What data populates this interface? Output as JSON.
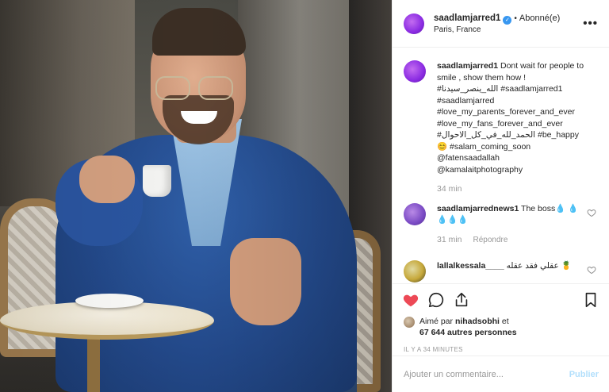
{
  "post": {
    "username": "saadlamjarred1",
    "verified_glyph": "✓",
    "follow_status": "Abonné(e)",
    "location": "Paris, France",
    "more_glyph": "•••"
  },
  "caption": {
    "username": "saadlamjarred1",
    "text": "Dont wait for people to smile , show them how ! #الله_ينصر_سيدنا #saadlamjarred1 #saadlamjarred #love_my_parents_forever_and_ever #love_my_fans_forever_and_ever #الحمد_لله_في_كل_الاحوال #be_happy😊 #salam_coming_soon @fatensaadallah @kamalaitphotography",
    "time": "34 min"
  },
  "comments": [
    {
      "username": "saadlamjarrednews1",
      "text": "The boss💧 💧💧💧💧",
      "time": "31 min",
      "reply": "Répondre"
    },
    {
      "username": "lallalkessala____",
      "text": "عقلي فقد عقله 🍍"
    }
  ],
  "icons": {
    "like": "heart-icon",
    "comment": "comment-icon",
    "share": "share-icon",
    "save": "bookmark-icon",
    "comment_like": "heart-outline-icon"
  },
  "colors": {
    "like_red": "#ed4956",
    "verified_blue": "#3897f0",
    "muted_gray": "#999999",
    "post_button": "#b2dffc"
  },
  "likes": {
    "prefix": "Aimé par",
    "first_user": "nihadsobhi",
    "conjunction": "et",
    "others": "67 644 autres personnes"
  },
  "timestamp": "IL Y A 34 MINUTES",
  "composer": {
    "placeholder": "Ajouter un commentaire...",
    "post_label": "Publier"
  }
}
